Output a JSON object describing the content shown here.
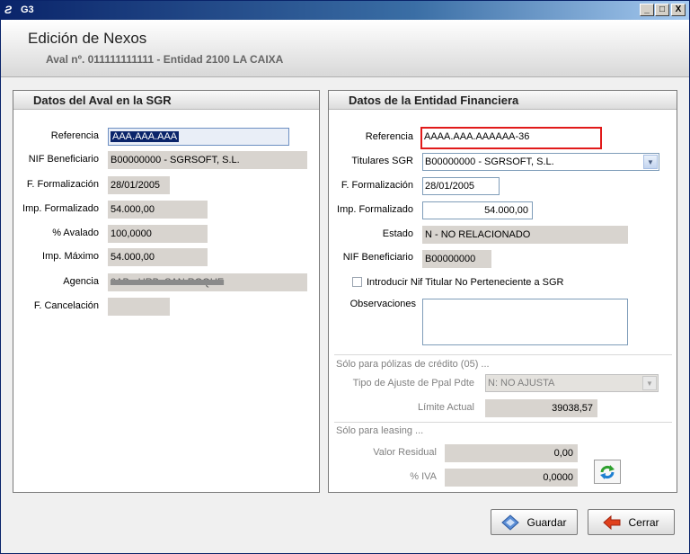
{
  "window": {
    "logo": "Ƨ",
    "title": "G3",
    "controls": {
      "minimize": "_",
      "maximize": "□",
      "close": "X"
    }
  },
  "header": {
    "title": "Edición de Nexos",
    "subtitle": "Aval nº. 011111111111 - Entidad 2100 LA CAIXA"
  },
  "left_panel": {
    "title": "Datos del Aval en la SGR",
    "fields": {
      "referencia": {
        "label": "Referencia",
        "value": "AAA.AAA.AAA"
      },
      "nif": {
        "label": "NIF Beneficiario",
        "value": "B00000000 - SGRSOFT, S.L."
      },
      "f_form": {
        "label": "F. Formalización",
        "value": "28/01/2005"
      },
      "imp_form": {
        "label": "Imp. Formalizado",
        "value": "54.000,00"
      },
      "avalado": {
        "label": "% Avalado",
        "value": "100,0000"
      },
      "imp_max": {
        "label": "Imp. Máximo",
        "value": "54.000,00"
      },
      "agencia": {
        "label": "Agencia",
        "value": "0AB • URB. SAN ROQUE"
      },
      "f_canc": {
        "label": "F. Cancelación",
        "value": ""
      }
    }
  },
  "right_panel": {
    "title": "Datos de la Entidad Financiera",
    "fields": {
      "referencia": {
        "label": "Referencia",
        "value": "AAAA.AAA.AAAAAA-36"
      },
      "titulares": {
        "label": "Titulares SGR",
        "value": "B00000000 - SGRSOFT, S.L."
      },
      "f_form": {
        "label": "F. Formalización",
        "value": "28/01/2005"
      },
      "imp_form": {
        "label": "Imp. Formalizado",
        "value": "54.000,00"
      },
      "estado": {
        "label": "Estado",
        "value": "N - NO  RELACIONADO"
      },
      "nif": {
        "label": "NIF Beneficiario",
        "value": "B00000000"
      },
      "introducir": {
        "label": "Introducir Nif Titular No Perteneciente a SGR",
        "checked": false
      },
      "observaciones": {
        "label": "Observaciones",
        "value": ""
      }
    },
    "credito": {
      "section": "Sólo para pólizas de crédito (05) ...",
      "tipo_label": "Tipo de Ajuste de Ppal Pdte",
      "tipo_value": "N: NO AJUSTA",
      "limite_label": "Límite Actual",
      "limite_value": "39038,57"
    },
    "leasing": {
      "section": "Sólo para leasing ...",
      "residual_label": "Valor Residual",
      "residual_value": "0,00",
      "iva_label": "% IVA",
      "iva_value": "0,0000"
    }
  },
  "footer": {
    "save_label": "Guardar",
    "close_label": "Cerrar"
  },
  "icons": [
    "combo-arrow-icon",
    "refresh-icon",
    "save-icon",
    "close-arrow-icon"
  ],
  "colors": {
    "highlight": "#e11a1a",
    "titlebar": "#0a246a",
    "field_bg": "#d8d4cf"
  }
}
